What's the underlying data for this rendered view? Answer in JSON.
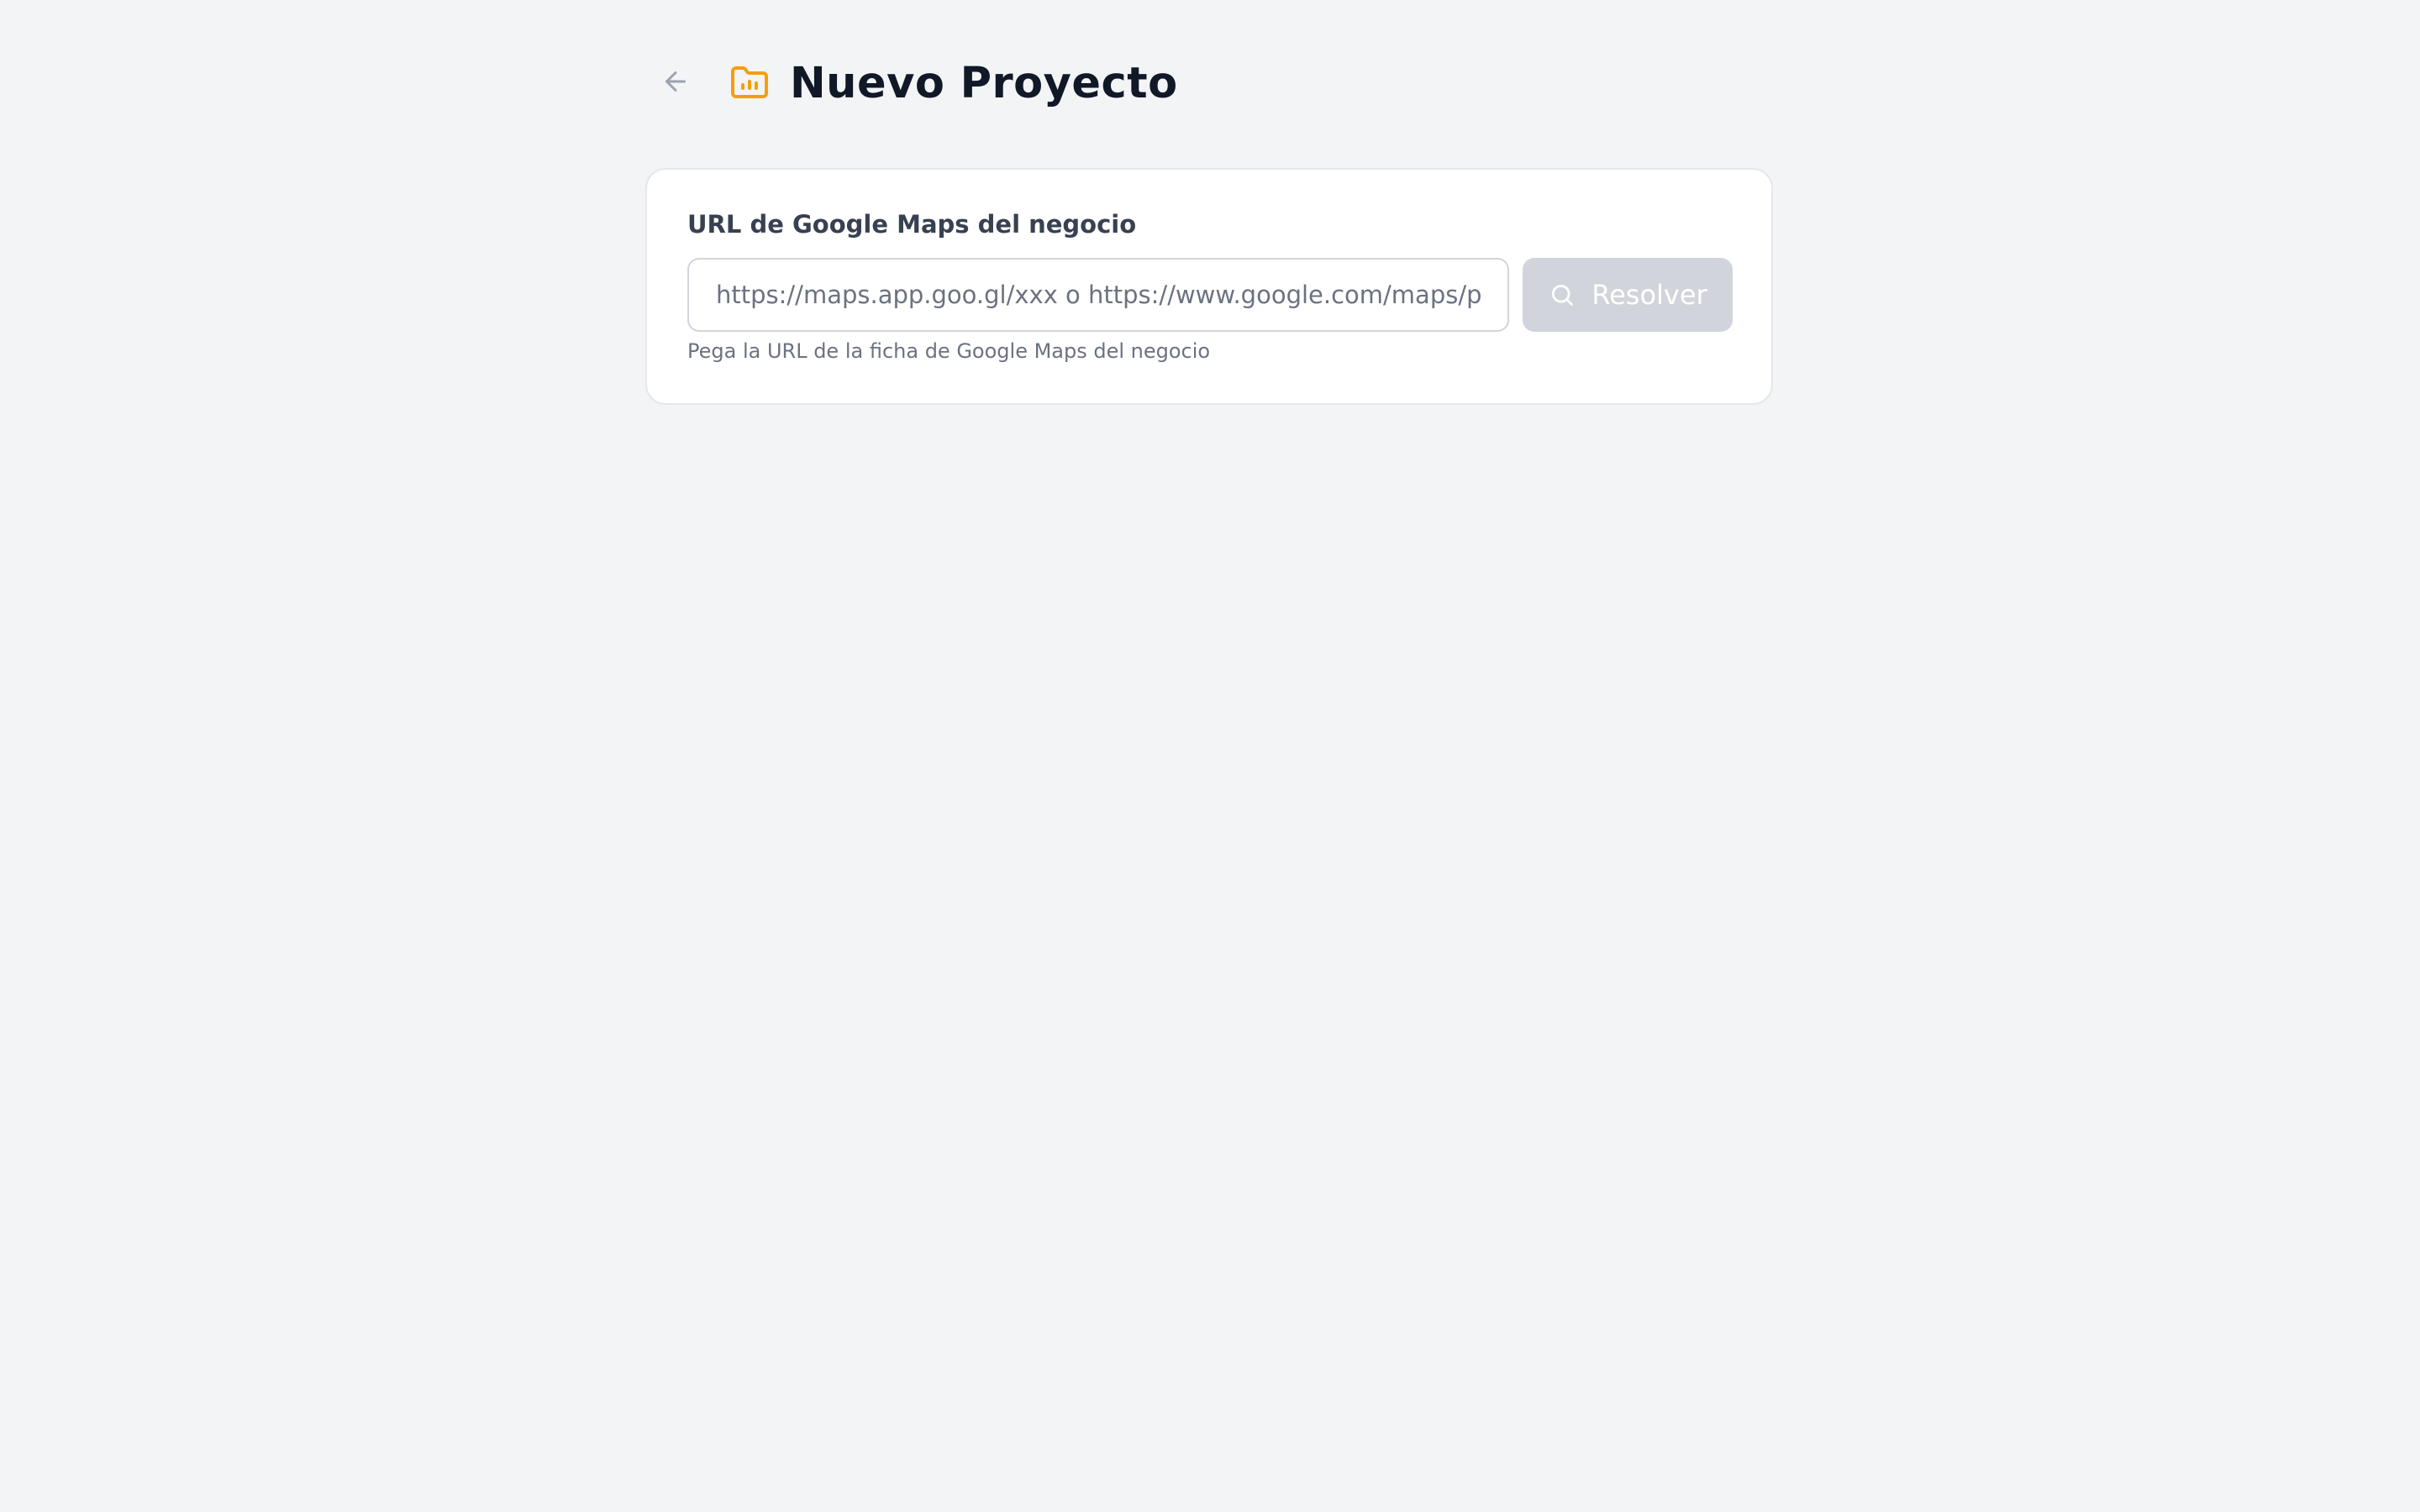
{
  "header": {
    "back_icon": "arrow-left-icon",
    "folder_icon": "folder-chart-icon",
    "title": "Nuevo Proyecto"
  },
  "form": {
    "label": "URL de Google Maps del negocio",
    "input": {
      "value": "",
      "placeholder": "https://maps.app.goo.gl/xxx o https://www.google.com/maps/place/..."
    },
    "resolve_button": {
      "label": "Resolver",
      "icon": "search-icon",
      "disabled": true
    },
    "helper": "Pega la URL de la ficha de Google Maps del negocio"
  },
  "colors": {
    "background": "#f3f4f6",
    "card": "#ffffff",
    "accent": "#f59e0b",
    "title": "#111827",
    "muted": "#6b7280",
    "button_disabled": "#d1d5db"
  }
}
